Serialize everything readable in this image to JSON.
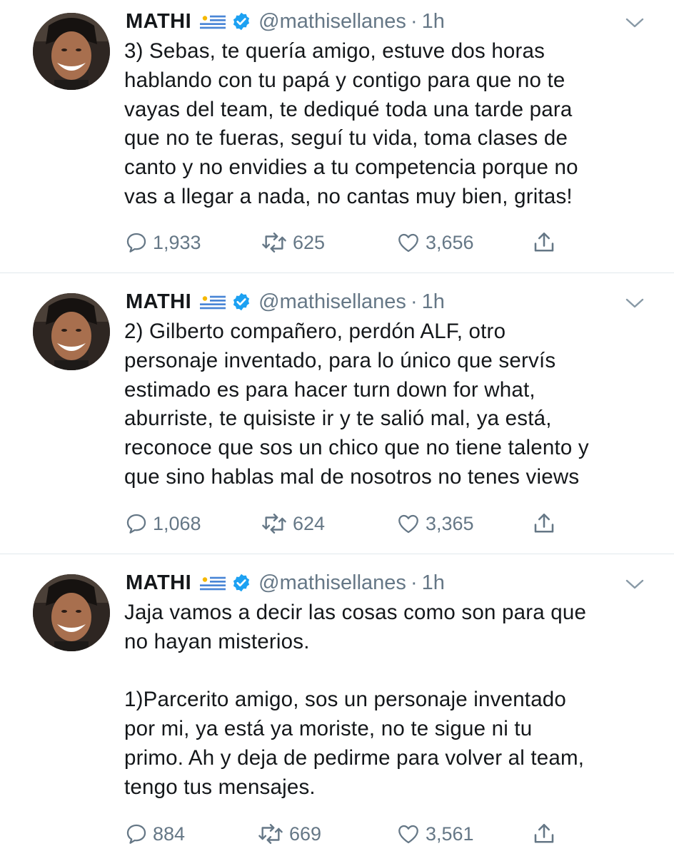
{
  "tweets": [
    {
      "name": "MATHI",
      "handle": "@mathisellanes",
      "dot": "·",
      "time": "1h",
      "text": "3) Sebas, te quería amigo, estuve dos horas\nhablando con tu papá y contigo para que no te\nvayas del team, te dediqué toda una tarde para\nque no te fueras, seguí tu vida, toma clases de\ncanto y no envidies a tu competencia porque no\nvas a llegar a nada, no cantas muy bien, gritas!",
      "replies": "1,933",
      "retweets": "625",
      "likes": "3,656"
    },
    {
      "name": "MATHI",
      "handle": "@mathisellanes",
      "dot": "·",
      "time": "1h",
      "text": "2) Gilberto compañero, perdón ALF, otro\npersonaje inventado, para lo único que servís\nestimado es para hacer turn down for what,\naburriste, te quisiste ir y te salió mal, ya está,\nreconoce que sos un chico que no tiene talento y\nque sino hablas mal de nosotros no tenes views",
      "replies": "1,068",
      "retweets": "624",
      "likes": "3,365"
    },
    {
      "name": "MATHI",
      "handle": "@mathisellanes",
      "dot": "·",
      "time": "1h",
      "text": "Jaja vamos a decir las cosas como son para que\nno hayan misterios.\n\n1)Parcerito amigo, sos un personaje inventado\npor mi, ya está ya moriste, no te sigue ni tu\nprimo. Ah y deja de pedirme para volver al team,\ntengo tus mensajes.",
      "replies": "884",
      "retweets": "669",
      "likes": "3,561"
    }
  ],
  "icons": {
    "flag": "uruguay-flag-icon",
    "verified": "verified-badge-icon",
    "menu": "chevron-down-icon",
    "reply": "reply-icon",
    "retweet": "retweet-icon",
    "like": "heart-icon",
    "share": "share-icon"
  },
  "colors": {
    "text": "#14171a",
    "secondary": "#657786",
    "verified": "#1da1f2",
    "divider": "#e1e8ed"
  }
}
